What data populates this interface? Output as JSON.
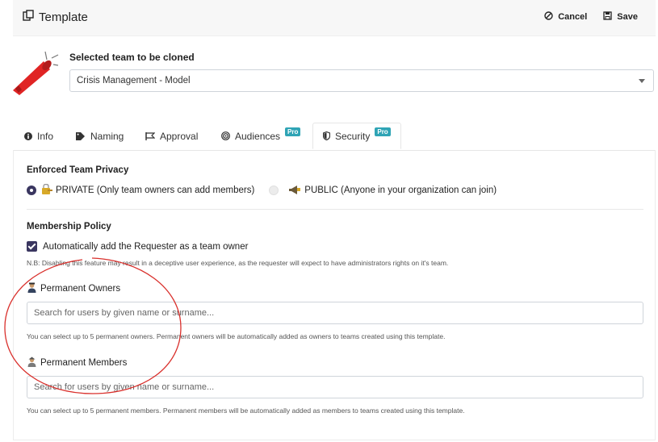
{
  "header": {
    "title": "Template",
    "cancel_label": "Cancel",
    "save_label": "Save"
  },
  "team_selector": {
    "label": "Selected team to be cloned",
    "value": "Crisis Management - Model"
  },
  "tabs": [
    {
      "label": "Info",
      "icon": "info-icon"
    },
    {
      "label": "Naming",
      "icon": "tag-icon"
    },
    {
      "label": "Approval",
      "icon": "flag-icon"
    },
    {
      "label": "Audiences",
      "icon": "target-icon",
      "badge": "Pro"
    },
    {
      "label": "Security",
      "icon": "shield-icon",
      "badge": "Pro",
      "active": true
    }
  ],
  "security": {
    "privacy_heading": "Enforced Team Privacy",
    "private_option": "PRIVATE (Only team owners can add members)",
    "public_option": "PUBLIC (Anyone in your organization can join)",
    "selected_privacy": "PRIVATE",
    "membership_heading": "Membership Policy",
    "auto_owner_label": "Automatically add the Requester as a team owner",
    "auto_owner_checked": true,
    "auto_owner_note": "N.B: Disabling this feature may result in a deceptive user experience, as the requester will expect to have administrators rights on it's team.",
    "owners_label": "Permanent Owners",
    "owners_placeholder": "Search for users by given name or surname...",
    "owners_help": "You can select up to 5 permanent owners. Permanent owners will be automatically added as owners to teams created using this template.",
    "members_label": "Permanent Members",
    "members_placeholder": "Search for users by given name or surname...",
    "members_help": "You can select up to 5 permanent members. Permanent members will be automatically added as members to teams created using this template."
  },
  "colors": {
    "accent": "#3a3660",
    "badge": "#2fa4b5",
    "annotation": "#d9302c"
  }
}
